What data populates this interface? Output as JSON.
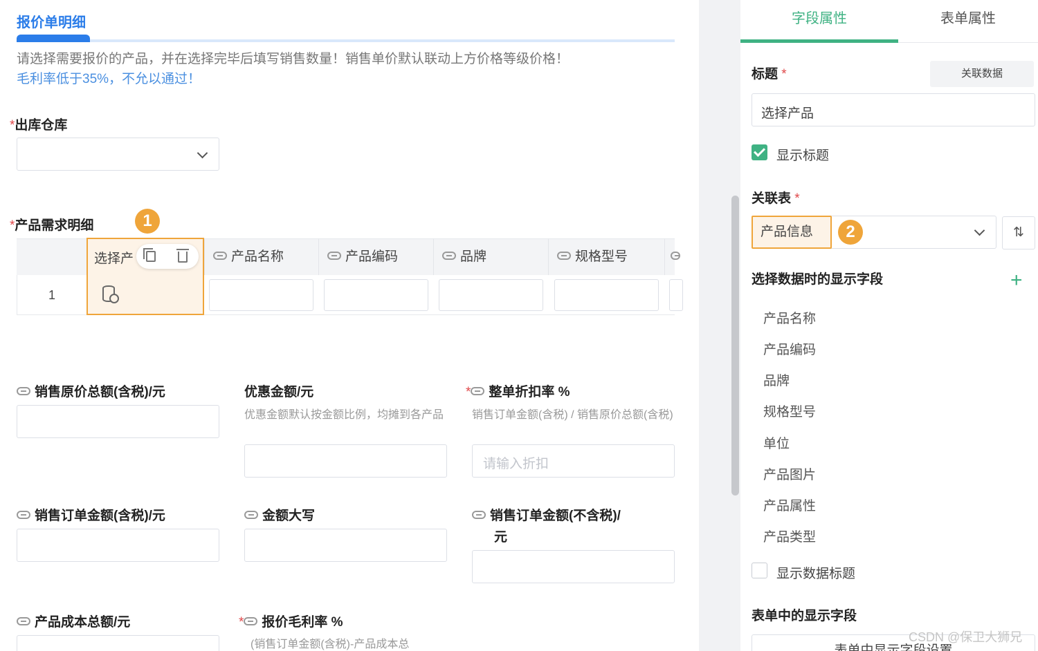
{
  "left": {
    "section_title": "报价单明细",
    "hint_line1": "请选择需要报价的产品，并在选择完毕后填写销售数量！销售单价默认联动上方价格等级价格！",
    "hint_line2": "毛利率低于35%，不允以通过！",
    "warehouse_label": "出库仓库",
    "product_detail_label": "产品需求明细",
    "badge1": "1",
    "table": {
      "columns": [
        "选择产",
        "产品名称",
        "产品编码",
        "品牌",
        "规格型号"
      ],
      "rows": [
        {
          "num": "1"
        }
      ]
    },
    "fields": {
      "sales_original_total_label": "销售原价总额(含税)/元",
      "discount_amount_label": "优惠金额/元",
      "discount_amount_note": "优惠金额默认按金额比例，均摊到各产品",
      "discount_rate_label": "整单折扣率 %",
      "discount_rate_note": "销售订单金额(含税) / 销售原价总额(含税)",
      "discount_rate_placeholder": "请输入折扣",
      "order_amount_tax_label": "销售订单金额(含税)/元",
      "amount_upper_label": "金额大写",
      "order_amount_notax_label_1": "销售订单金额(不含税)/",
      "order_amount_notax_label_2": "元",
      "product_cost_total_label": "产品成本总额/元",
      "gross_margin_label": "报价毛利率 %",
      "gross_margin_note": "(销售订单金额(含税)-产品成本总"
    }
  },
  "right": {
    "tabs": [
      {
        "label": "字段属性",
        "active": true
      },
      {
        "label": "表单属性",
        "active": false
      }
    ],
    "title_label": "标题",
    "related_data_button": "关联数据",
    "title_value": "选择产品",
    "show_title_label": "显示标题",
    "show_title_checked": true,
    "related_table_label": "关联表",
    "related_table_value": "产品信息",
    "badge2": "2",
    "display_fields_label": "选择数据时的显示字段",
    "display_fields": [
      "产品名称",
      "产品编码",
      "品牌",
      "规格型号",
      "单位",
      "产品图片",
      "产品属性",
      "产品类型"
    ],
    "show_data_title_label": "显示数据标题",
    "show_data_title_checked": false,
    "form_display_fields_label": "表单中的显示字段",
    "form_display_settings_button": "表单中显示字段设置"
  },
  "watermark": "CSDN @保卫大狮兄",
  "colors": {
    "accent_blue": "#2b7de9",
    "accent_green": "#3fb283",
    "highlight_orange": "#efa53a",
    "required_red": "#e0484a"
  }
}
